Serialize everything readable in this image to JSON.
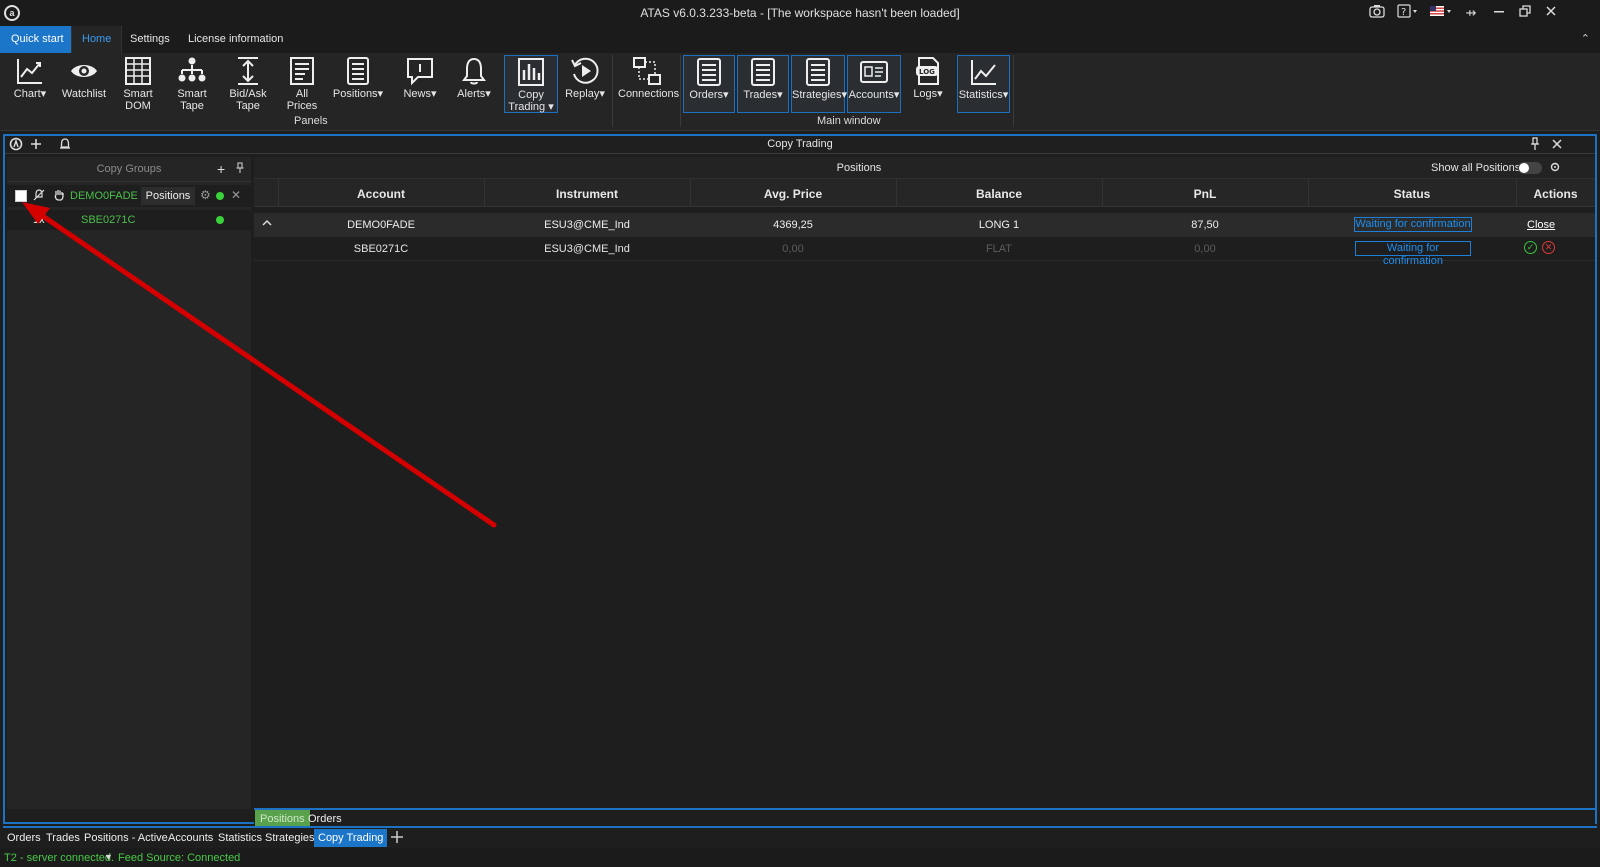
{
  "app": {
    "title": "ATAS v6.0.3.233-beta - [The workspace hasn't been loaded]",
    "logo_letter": "Ɑ"
  },
  "ribbon_tabs": {
    "quick_start": "Quick start",
    "home": "Home",
    "settings": "Settings",
    "license": "License information"
  },
  "ribbon": {
    "chart": "Chart▾",
    "watchlist": "Watchlist",
    "smart_dom_1": "Smart",
    "smart_dom_2": "DOM",
    "smart_tape_1": "Smart",
    "smart_tape_2": "Tape",
    "bidask_1": "Bid/Ask",
    "bidask_2": "Tape",
    "allprices_1": "All",
    "allprices_2": "Prices",
    "positions": "Positions▾",
    "news": "News▾",
    "alerts": "Alerts▾",
    "copy_trading_1": "Copy",
    "copy_trading_2": "Trading ▾",
    "replay": "Replay▾",
    "connections": "Connections",
    "orders": "Orders▾",
    "trades": "Trades▾",
    "strategies": "Strategies▾",
    "accounts": "Accounts▾",
    "logs": "Logs▾",
    "statistics": "Statistics▾",
    "group_panels": "Panels",
    "group_main": "Main window"
  },
  "copy_trading": {
    "window_title": "Copy Trading",
    "left": {
      "header": "Copy Groups",
      "group": {
        "name": "DEMO0FADE",
        "positions_btn": "Positions"
      },
      "subscriber": {
        "multiplier": "1x",
        "name": "SBE0271C"
      }
    },
    "right": {
      "header": "Positions",
      "show_all": "Show all Positions",
      "columns": [
        "Account",
        "Instrument",
        "Avg. Price",
        "Balance",
        "PnL",
        "Status",
        "Actions"
      ],
      "rows": [
        {
          "account": "DEMO0FADE",
          "instrument": "ESU3@CME_Ind",
          "avg_price": "4369,25",
          "balance": "LONG 1",
          "pnl": "87,50",
          "status": "Waiting for confirmation",
          "action": "Close"
        },
        {
          "account": "SBE0271C",
          "instrument": "ESU3@CME_Ind",
          "avg_price": "0,00",
          "balance": "FLAT",
          "pnl": "0,00",
          "status": "Waiting for confirmation"
        }
      ],
      "inner_tabs": [
        "Positions",
        "Orders"
      ]
    }
  },
  "bottom_tabs": [
    "Orders",
    "Trades",
    "Positions - Active",
    "Accounts",
    "Statistics",
    "Strategies",
    "Copy Trading"
  ],
  "status_bar": {
    "server": "T2 - server connected.",
    "feed": "Feed Source: Connected"
  },
  "colors": {
    "accent": "#1b75c9",
    "green": "#4cbf4c",
    "annotation_arrow": "#d40000"
  }
}
